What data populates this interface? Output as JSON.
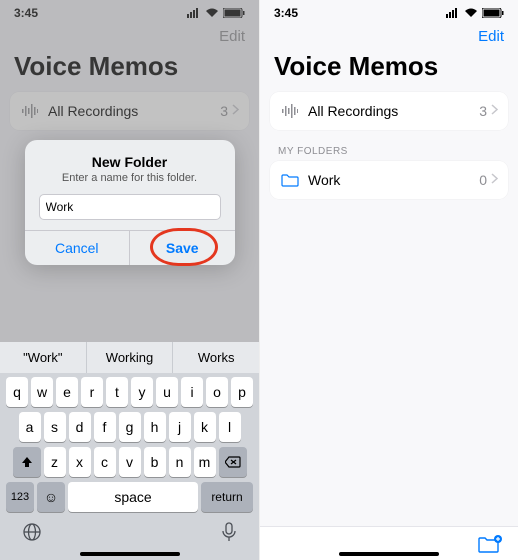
{
  "statusbar": {
    "time": "3:45",
    "carrier_arrow": "↗"
  },
  "left": {
    "edit": "Edit",
    "title": "Voice Memos",
    "all_label": "All Recordings",
    "all_count": "3",
    "alert": {
      "title": "New Folder",
      "message": "Enter a name for this folder.",
      "value": "Work",
      "cancel": "Cancel",
      "save": "Save"
    },
    "predictions": [
      "\"Work\"",
      "Working",
      "Works"
    ],
    "keys_r1": [
      "q",
      "w",
      "e",
      "r",
      "t",
      "y",
      "u",
      "i",
      "o",
      "p"
    ],
    "keys_r2": [
      "a",
      "s",
      "d",
      "f",
      "g",
      "h",
      "j",
      "k",
      "l"
    ],
    "keys_r3": [
      "z",
      "x",
      "c",
      "v",
      "b",
      "n",
      "m"
    ],
    "space": "space",
    "return": "return",
    "numkey": "123"
  },
  "right": {
    "edit": "Edit",
    "title": "Voice Memos",
    "all_label": "All Recordings",
    "all_count": "3",
    "section": "MY FOLDERS",
    "folder_label": "Work",
    "folder_count": "0"
  }
}
